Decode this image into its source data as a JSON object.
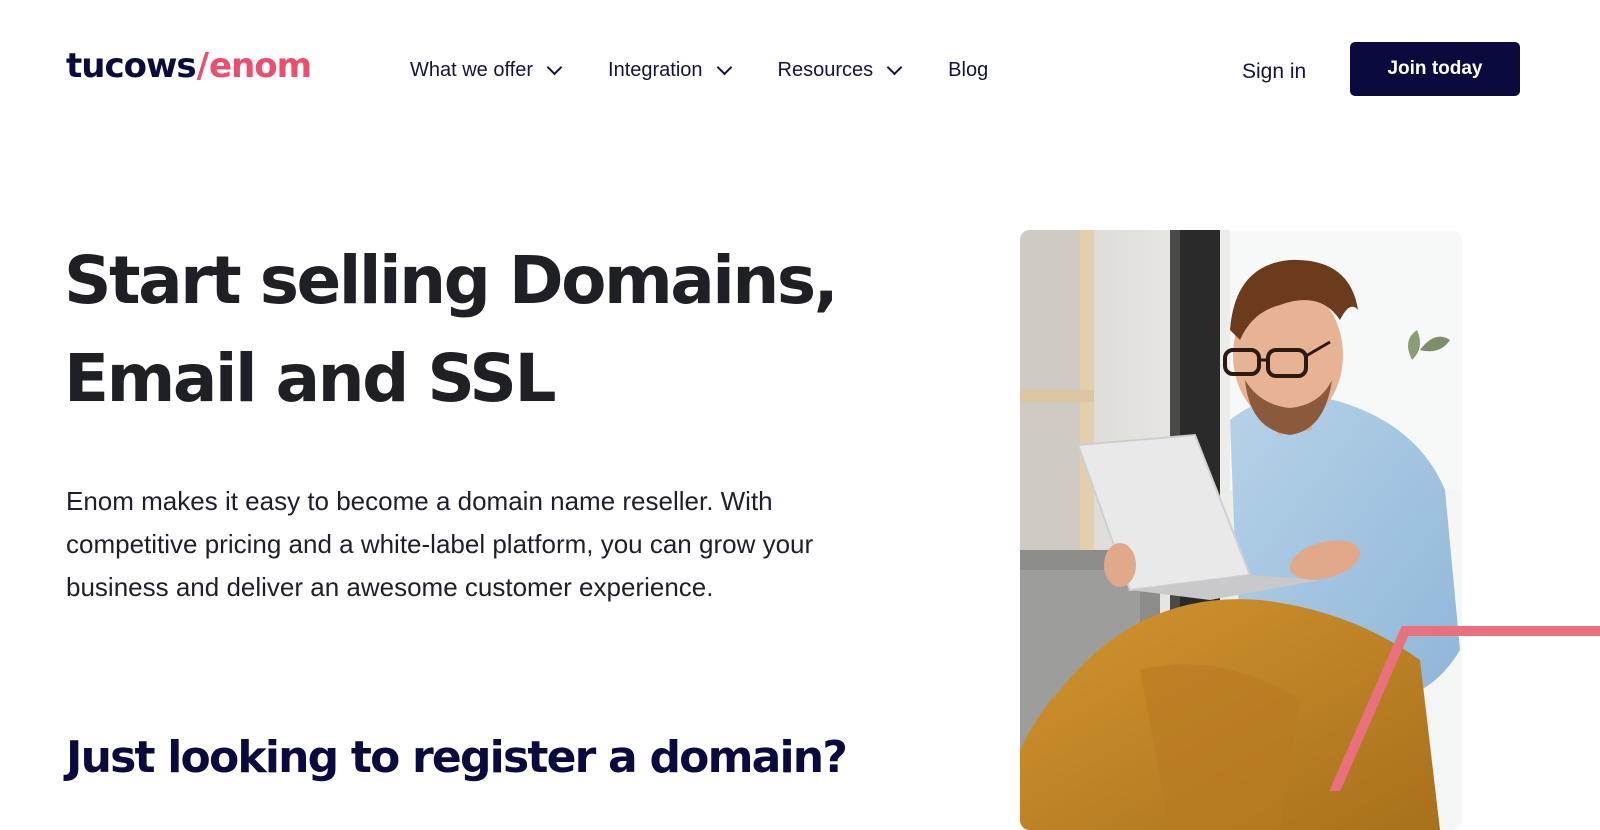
{
  "header": {
    "logo": {
      "part_a": "tucows",
      "slash": "/",
      "part_b": "enom"
    },
    "nav": [
      {
        "label": "What we offer",
        "has_dropdown": true
      },
      {
        "label": "Integration",
        "has_dropdown": true
      },
      {
        "label": "Resources",
        "has_dropdown": true
      },
      {
        "label": "Blog",
        "has_dropdown": false
      }
    ],
    "signin_label": "Sign in",
    "join_label": "Join today"
  },
  "hero": {
    "title_line1": "Start selling Domains,",
    "title_line2": "Email and SSL",
    "description": "Enom makes it easy to become a domain name reseller. With competitive pricing and a white-label platform, you can grow your business and deliver an awesome customer experience.",
    "subheading": "Just looking to register a domain?"
  },
  "colors": {
    "navy": "#0b0a3e",
    "accent_pink": "#ee4e6e",
    "text": "#1f1f2b",
    "background": "#ffffff"
  }
}
